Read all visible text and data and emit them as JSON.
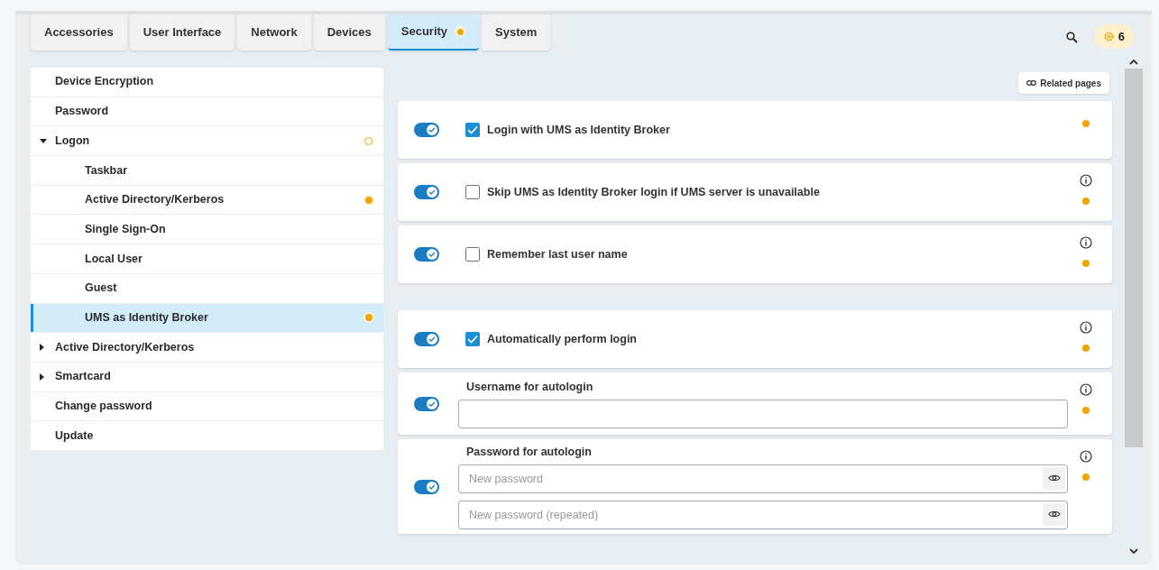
{
  "tabs": [
    {
      "label": "Accessories",
      "selected": false,
      "modified": false
    },
    {
      "label": "User Interface",
      "selected": false,
      "modified": false
    },
    {
      "label": "Network",
      "selected": false,
      "modified": false
    },
    {
      "label": "Devices",
      "selected": false,
      "modified": false
    },
    {
      "label": "Security",
      "selected": true,
      "modified": true
    },
    {
      "label": "System",
      "selected": false,
      "modified": false
    }
  ],
  "changes_badge": {
    "count": "6"
  },
  "sidebar": {
    "items": [
      {
        "label": "Device Encryption",
        "selected": false
      },
      {
        "label": "Password",
        "selected": false
      },
      {
        "label": "Logon",
        "selected": false,
        "expanded": true,
        "changed_inside": true,
        "children": [
          {
            "label": "Taskbar",
            "selected": false
          },
          {
            "label": "Active Directory/Kerberos",
            "selected": false,
            "changed": true
          },
          {
            "label": "Single Sign-On",
            "selected": false
          },
          {
            "label": "Local User",
            "selected": false
          },
          {
            "label": "Guest",
            "selected": false
          },
          {
            "label": "UMS as Identity Broker",
            "selected": true,
            "changed": true
          }
        ]
      },
      {
        "label": "Active Directory/Kerberos",
        "selected": false,
        "expanded": false
      },
      {
        "label": "Smartcard",
        "selected": false,
        "expanded": false
      },
      {
        "label": "Change password",
        "selected": false
      },
      {
        "label": "Update",
        "selected": false
      }
    ]
  },
  "related_pages": {
    "label": "Related pages"
  },
  "setting_groups": [
    {
      "settings": [
        {
          "kind": "checkbox",
          "enabled": true,
          "checked": true,
          "label": "Login with UMS as Identity Broker",
          "info": false,
          "modified": true
        },
        {
          "kind": "checkbox",
          "enabled": true,
          "checked": false,
          "label": "Skip UMS as Identity Broker login if UMS server is unavailable",
          "info": true,
          "modified": true
        },
        {
          "kind": "checkbox",
          "enabled": true,
          "checked": false,
          "label": "Remember last user name",
          "info": true,
          "modified": true
        }
      ]
    },
    {
      "settings": [
        {
          "kind": "checkbox",
          "enabled": true,
          "checked": true,
          "label": "Automatically perform login",
          "info": true,
          "modified": true
        },
        {
          "kind": "text",
          "enabled": true,
          "label": "Username for autologin",
          "info": true,
          "modified": true
        },
        {
          "kind": "password",
          "enabled": true,
          "label": "Password for autologin",
          "placeholder": "New password",
          "repeat_placeholder": "New password (repeated)",
          "info": true,
          "modified": true
        }
      ]
    }
  ]
}
